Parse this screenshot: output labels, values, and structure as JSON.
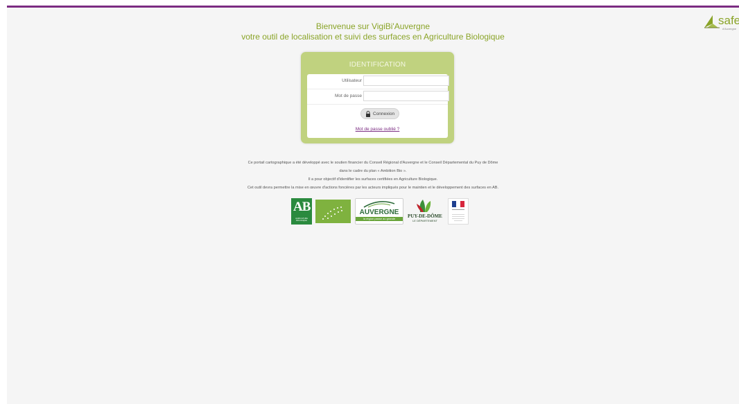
{
  "header": {
    "line1": "Bienvenue sur VigiBi'Auvergne",
    "line2": "votre outil de localisation et suivi des surfaces en Agriculture Biologique"
  },
  "brand": {
    "safer_text": "safe",
    "safer_sub": "d'Auvergne",
    "accent_color": "#8aa428",
    "top_bar_color": "#7b2c82"
  },
  "login": {
    "title": "IDENTIFICATION",
    "user_label": "Utilisateur",
    "user_value": "",
    "password_label": "Mot de passe",
    "password_value": "",
    "submit_label": "Connexion",
    "submit_icon": "lock-icon",
    "forgot_link": "Mot de passe oublié ?"
  },
  "description": {
    "lines": [
      "Ce portail cartographique a été développé avec le soutien financier du Conseil Régional d'Auvergne et le Conseil Départemental du Puy de Dôme",
      "dans le cadre du plan « Ambition Bio ».",
      "Il a pour objectif d'identifier les surfaces certifiées en Agriculture Biologique.",
      "Cet outil devra permettre la mise en œuvre d'actions foncières par les acteurs impliqués pour le maintien et le développement des surfaces en AB."
    ]
  },
  "logos": {
    "ab": {
      "text": "AB",
      "sub": "AGRICULTURE BIOLOGIQUE"
    },
    "eu": {
      "name": "eu-organic-leaf-logo"
    },
    "auvergne": {
      "text": "AUVERGNE",
      "sub": "la région passe au grande"
    },
    "puy_de_dome": {
      "text": "PUY-DE-DÔME",
      "sub": "LE DÉPARTEMENT"
    },
    "prefet": {
      "name": "marianne-prefet-logo"
    }
  }
}
